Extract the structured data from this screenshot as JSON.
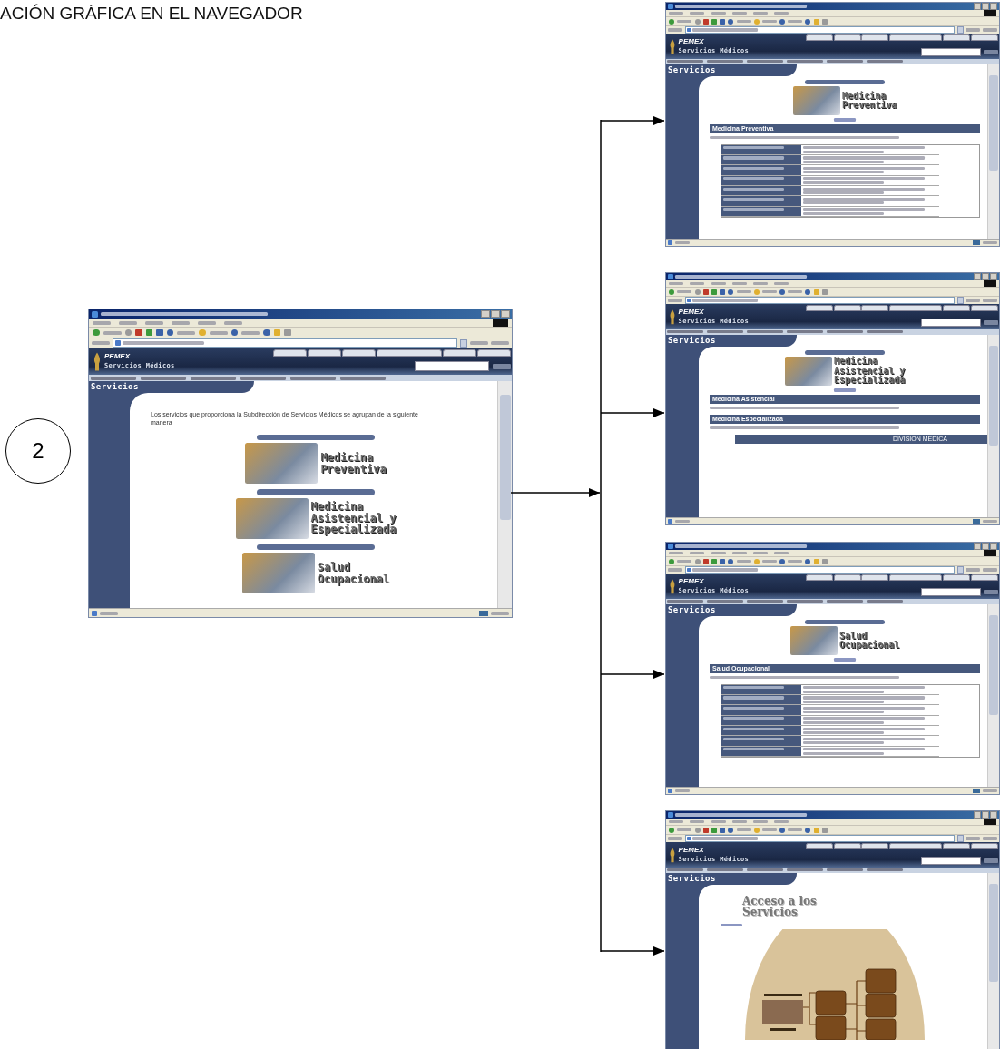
{
  "heading": "ACIÓN GRÁFICA EN EL NAVEGADOR",
  "step_label": "2",
  "windows": [
    {
      "site": {
        "brand": "PEMEX",
        "subtitle": "Servicios Médicos",
        "section": "Servicios"
      },
      "content": {
        "kind": "intro",
        "text": "Los servicios que proporciona la Subdirección de Servicios Médicos se agrupan de la siguiente manera",
        "banners": [
          {
            "lines": [
              "Medicina",
              "Preventiva"
            ]
          },
          {
            "lines": [
              "Medicina",
              "Asistencial y",
              "Especializada"
            ]
          },
          {
            "lines": [
              "Salud",
              "Ocupacional"
            ]
          }
        ]
      }
    },
    {
      "site": {
        "brand": "PEMEX",
        "subtitle": "Servicios Médicos",
        "section": "Servicios"
      },
      "content": {
        "kind": "detail",
        "banner": {
          "lines": [
            "Medicina",
            "Preventiva"
          ]
        },
        "sections": [
          {
            "kind": "table",
            "title": "Medicina Preventiva"
          }
        ]
      }
    },
    {
      "site": {
        "brand": "PEMEX",
        "subtitle": "Servicios Médicos",
        "section": "Servicios"
      },
      "content": {
        "kind": "detail",
        "banner": {
          "lines": [
            "Medicina",
            "Asistencial y",
            "Especializada"
          ]
        },
        "sections": [
          {
            "kind": "text",
            "title": "Medicina Asistencial"
          },
          {
            "kind": "division",
            "title": "Medicina Especializada",
            "table_header": "DIVISION MEDICA"
          }
        ]
      }
    },
    {
      "site": {
        "brand": "PEMEX",
        "subtitle": "Servicios Médicos",
        "section": "Servicios"
      },
      "content": {
        "kind": "detail",
        "banner": {
          "lines": [
            "Salud",
            "Ocupacional"
          ]
        },
        "sections": [
          {
            "kind": "table",
            "title": "Salud Ocupacional"
          }
        ]
      }
    },
    {
      "site": {
        "brand": "PEMEX",
        "subtitle": "Servicios Médicos",
        "section": "Servicios"
      },
      "content": {
        "kind": "access",
        "lines": [
          "Acceso a los",
          "Servicios"
        ]
      }
    }
  ]
}
